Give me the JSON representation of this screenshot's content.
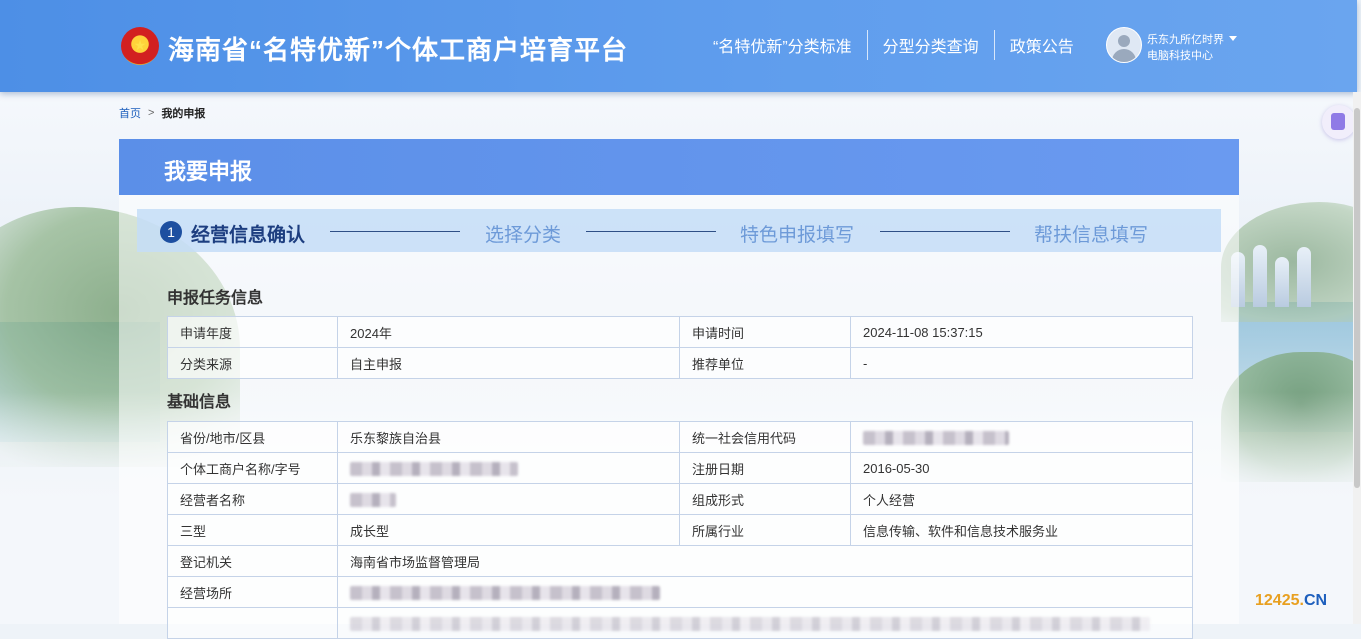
{
  "header": {
    "site_title": "海南省“名特优新”个体工商户培育平台",
    "emblem_char": "★",
    "nav": [
      "“名特优新”分类标准",
      "分型分类查询",
      "政策公告"
    ],
    "user_name": "乐东九所亿时界",
    "user_org": "电脑科技中心"
  },
  "breadcrumb": {
    "home": "首页",
    "separator": ">",
    "current": "我的申报"
  },
  "panel": {
    "title": "我要申报",
    "steps": [
      {
        "num": "1",
        "label": "经营信息确认",
        "state": "active"
      },
      {
        "label": "选择分类",
        "state": "todo"
      },
      {
        "label": "特色申报填写",
        "state": "todo"
      },
      {
        "label": "帮扶信息填写",
        "state": "todo"
      }
    ]
  },
  "task_info": {
    "title": "申报任务信息",
    "rows": [
      {
        "label1": "申请年度",
        "value1": "2024年",
        "label2": "申请时间",
        "value2": "2024-11-08 15:37:15"
      },
      {
        "label1": "分类来源",
        "value1": "自主申报",
        "label2": "推荐单位",
        "value2": "-"
      }
    ]
  },
  "basic_info": {
    "title": "基础信息",
    "rows": [
      {
        "label1": "省份/地市/区县",
        "value1": "乐东黎族自治县",
        "label2": "统一社会信用代码",
        "value2": ""
      },
      {
        "label1": "个体工商户名称/字号",
        "value1": "",
        "label2": "注册日期",
        "value2": "2016-05-30"
      },
      {
        "label1": "经营者名称",
        "value1": "",
        "label2": "组成形式",
        "value2": "个人经营"
      },
      {
        "label1": "三型",
        "value1": "成长型",
        "label2": "所属行业",
        "value2": "信息传输、软件和信息技术服务业"
      },
      {
        "label1": "登记机关",
        "value1": "海南省市场监督管理局"
      },
      {
        "label1": "经营场所",
        "value1": ""
      }
    ]
  },
  "watermark": {
    "prefix": "12425.",
    "suffix": "CN"
  },
  "colors": {
    "header": "#5f9ded",
    "panel_head": "#5b8fe8",
    "step_active": "#1d3e80",
    "step_todo": "#6d9ad8",
    "table_border": "#c5d3e8"
  }
}
